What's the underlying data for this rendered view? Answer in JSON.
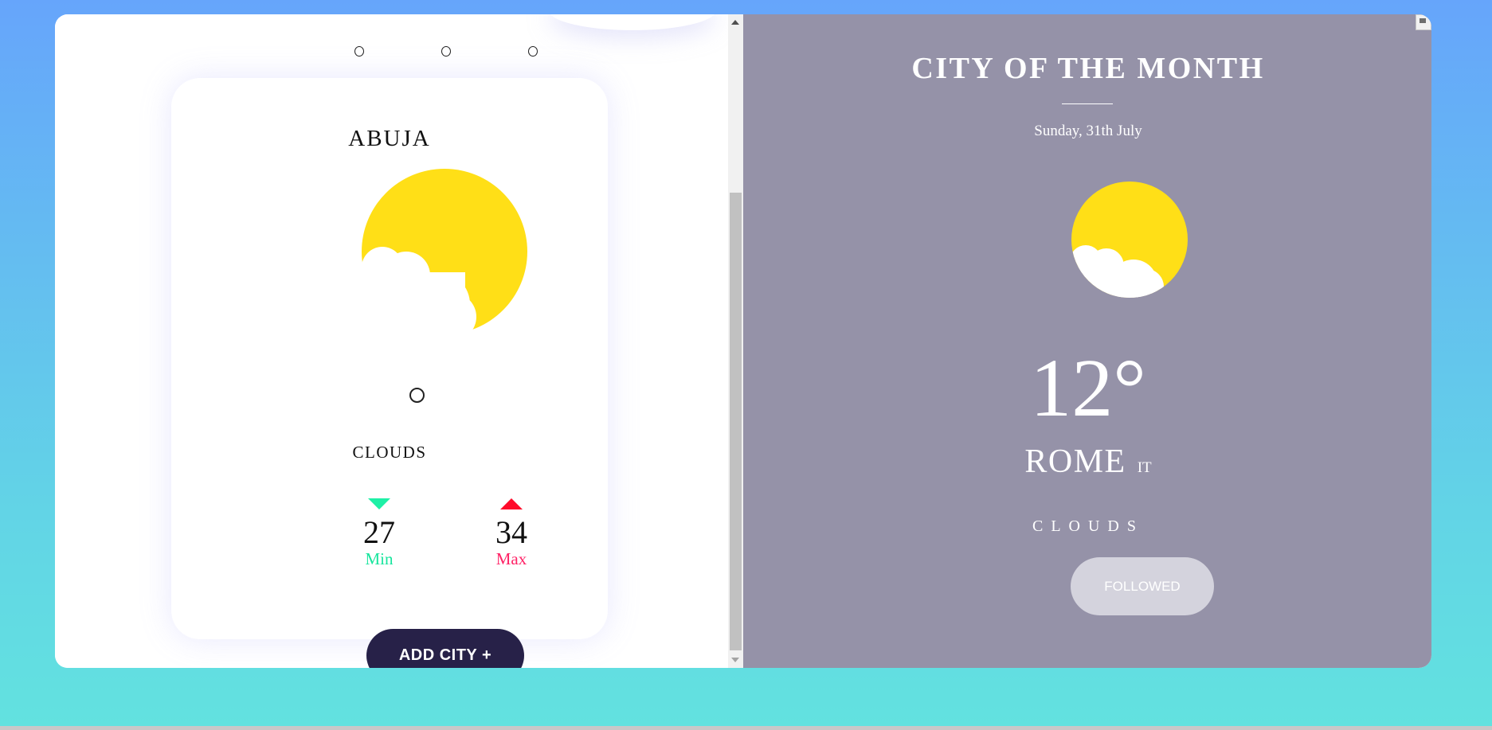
{
  "city_list": {
    "pagination_dots": [
      "dot-1",
      "dot-2",
      "dot-3"
    ],
    "card": {
      "city": "ABUJA",
      "weather_icon": "sun-cloud-icon",
      "weather": "CLOUDS",
      "min": {
        "value": "27",
        "label": "Min"
      },
      "max": {
        "value": "34",
        "label": "Max"
      }
    },
    "add_city_label": "ADD CITY +"
  },
  "city_of_month": {
    "title": "CITY OF THE MONTH",
    "date": "Sunday, 31th July",
    "weather_icon": "sun-cloud-icon",
    "temperature": "12°",
    "city": "ROME",
    "country": "IT",
    "weather": "CLOUDS",
    "follow_label": "FOLLOWED"
  },
  "colors": {
    "sun": "#ffdf17",
    "min_accent": "#1ef0a6",
    "max_accent": "#ff0a2a",
    "add_button_bg": "#272148",
    "panel_bg": "#9592a8",
    "followed_button_bg": "#d4d3dd"
  }
}
